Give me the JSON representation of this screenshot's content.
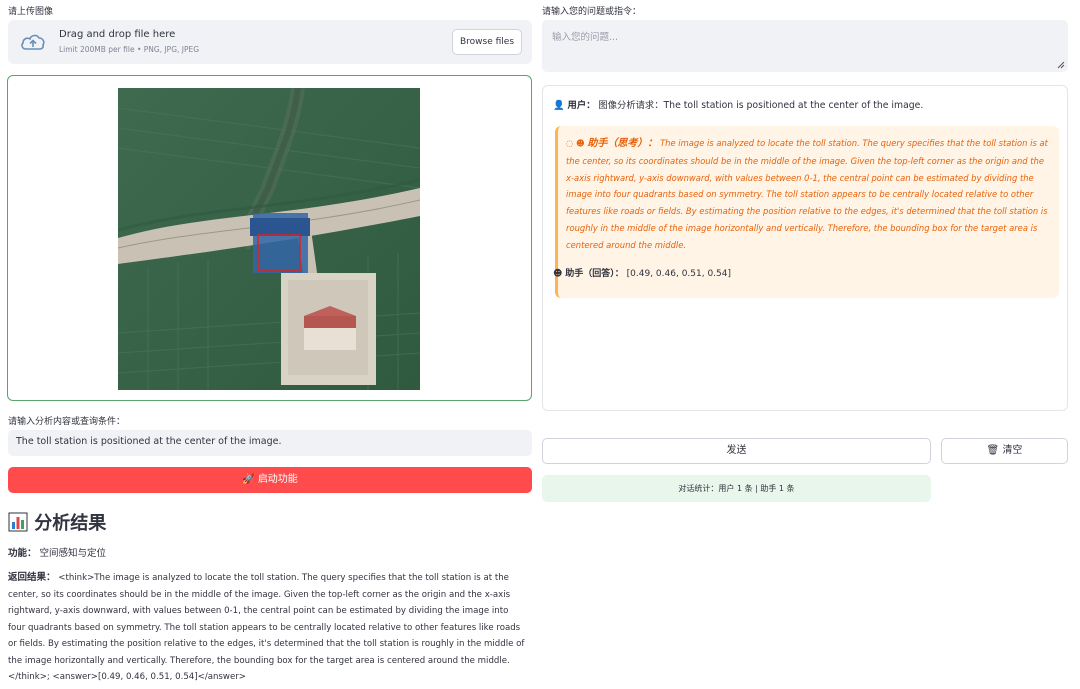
{
  "left": {
    "upload_label": "请上传图像",
    "uploader": {
      "title": "Drag and drop file here",
      "limit": "Limit 200MB per file • PNG, JPG, JPEG",
      "browse_label": "Browse files"
    },
    "image": {
      "icon": "satellite-image",
      "highlight_color": "#e02020"
    },
    "query_label": "请输入分析内容或查询条件：",
    "query_value": "The toll station is positioned at the center of the image.",
    "run_button": "启动功能",
    "result_heading": "分析结果",
    "function_label": "功能：",
    "function_value": "空间感知与定位",
    "result_label": "返回结果：",
    "result_text": "<think>The image is analyzed to locate the toll station. The query specifies that the toll station is at the center, so its coordinates should be in the middle of the image. Given the top-left corner as the origin and the x-axis rightward, y-axis downward, with values between 0-1, the central point can be estimated by dividing the image into four quadrants based on symmetry. The toll station appears to be centrally located relative to other features like roads or fields. By estimating the position relative to the edges, it's determined that the toll station is roughly in the middle of the image horizontally and vertically. Therefore, the bounding box for the target area is centered around the middle.</think>; <answer>[0.49, 0.46, 0.51, 0.54]</answer>"
  },
  "right": {
    "question_label": "请输入您的问题或指令：",
    "question_placeholder": "输入您的问题...",
    "user_label": "用户：",
    "user_message": "图像分析请求：The toll station is positioned at the center of the image.",
    "think_label": "助手（思考）：",
    "think_text": "The image is analyzed to locate the toll station. The query specifies that the toll station is at the center, so its coordinates should be in the middle of the image. Given the top-left corner as the origin and the x-axis rightward, y-axis downward, with values between 0-1, the central point can be estimated by dividing the image into four quadrants based on symmetry. The toll station appears to be centrally located relative to other features like roads or fields. By estimating the position relative to the edges, it's determined that the toll station is roughly in the middle of the image horizontally and vertically. Therefore, the bounding box for the target area is centered around the middle.",
    "answer_label": "助手（回答）：",
    "answer_text": "[0.49, 0.46, 0.51, 0.54]",
    "send_button": "发送",
    "clear_button": "清空",
    "stats": "对话统计：用户 1 条 | 助手 1 条"
  },
  "colors": {
    "primary": "#ff4b4b",
    "think_text": "#e8620a",
    "think_bg": "#fff4e6",
    "stats_bg": "#e8f6ec",
    "image_border": "#5aa36a"
  }
}
